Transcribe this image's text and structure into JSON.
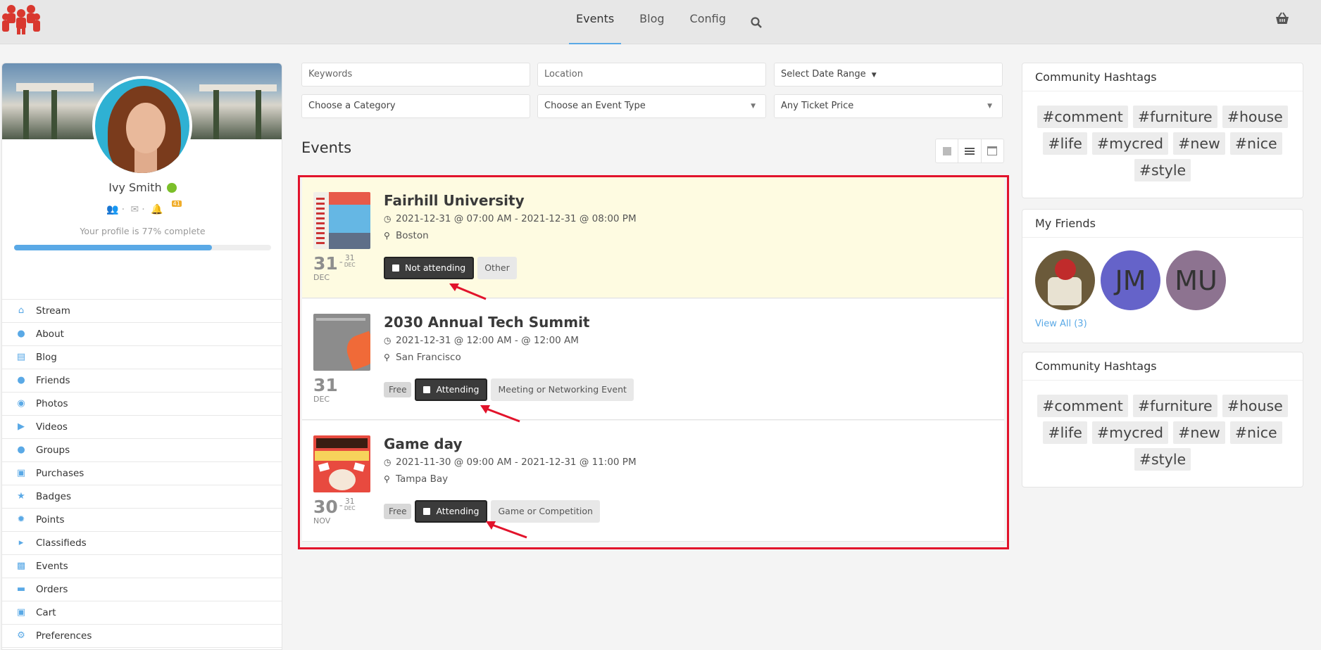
{
  "nav": {
    "links": [
      "Events",
      "Blog",
      "Config"
    ],
    "active": "Events"
  },
  "profile": {
    "name": "Ivy Smith",
    "notification_count": "41",
    "completion_text": "Your profile is 77% complete",
    "completion": 0.77
  },
  "sidebar": {
    "items": [
      {
        "label": "Stream",
        "icon": "home-icon"
      },
      {
        "label": "About",
        "icon": "user-icon"
      },
      {
        "label": "Blog",
        "icon": "blog-icon"
      },
      {
        "label": "Friends",
        "icon": "users-icon"
      },
      {
        "label": "Photos",
        "icon": "camera-icon"
      },
      {
        "label": "Videos",
        "icon": "video-icon"
      },
      {
        "label": "Groups",
        "icon": "group-icon"
      },
      {
        "label": "Purchases",
        "icon": "cart-icon"
      },
      {
        "label": "Badges",
        "icon": "star-icon"
      },
      {
        "label": "Points",
        "icon": "badge-icon"
      },
      {
        "label": "Classifieds",
        "icon": "megaphone-icon"
      },
      {
        "label": "Events",
        "icon": "calendar-icon"
      },
      {
        "label": "Orders",
        "icon": "card-icon"
      },
      {
        "label": "Cart",
        "icon": "cart-icon"
      },
      {
        "label": "Preferences",
        "icon": "gear-icon"
      }
    ]
  },
  "filters": {
    "keywords_placeholder": "Keywords",
    "location_placeholder": "Location",
    "date_range": "Select Date Range",
    "category": "Choose a Category",
    "event_type": "Choose an Event Type",
    "ticket_price": "Any Ticket Price"
  },
  "events_title": "Events",
  "events": [
    {
      "title": "Fairhill University",
      "datetime": "2021-12-31 @ 07:00 AM - 2021-12-31 @ 08:00 PM",
      "location": "Boston",
      "start_day": "31",
      "start_month": "DEC",
      "end_day": "31",
      "end_month": "DEC",
      "free": "",
      "status": "Not attending",
      "category": "Other"
    },
    {
      "title": "2030 Annual Tech Summit",
      "datetime": "2021-12-31 @ 12:00 AM - @ 12:00 AM",
      "location": "San Francisco",
      "start_day": "31",
      "start_month": "DEC",
      "end_day": "",
      "end_month": "",
      "free": "Free",
      "status": "Attending",
      "category": "Meeting or Networking Event"
    },
    {
      "title": "Game day",
      "datetime": "2021-11-30 @ 09:00 AM - 2021-12-31 @ 11:00 PM",
      "location": "Tampa Bay",
      "start_day": "30",
      "start_month": "NOV",
      "end_day": "31",
      "end_month": "DEC",
      "free": "Free",
      "status": "Attending",
      "category": "Game or Competition"
    }
  ],
  "hashtags_1": {
    "title": "Community Hashtags",
    "tags": [
      "#comment",
      "#furniture",
      "#house",
      "#life",
      "#mycred",
      "#new",
      "#nice",
      "#style"
    ]
  },
  "friends": {
    "title": "My Friends",
    "initials": [
      "JM",
      "MU"
    ],
    "view_all": "View All (3)"
  },
  "hashtags_2": {
    "title": "Community Hashtags",
    "tags": [
      "#comment",
      "#furniture",
      "#house",
      "#life",
      "#mycred",
      "#new",
      "#nice",
      "#style"
    ]
  },
  "colors": {
    "accent": "#5aa9e6",
    "highlight_frame": "#e2132b",
    "highlight_row": "#fefbe1"
  }
}
